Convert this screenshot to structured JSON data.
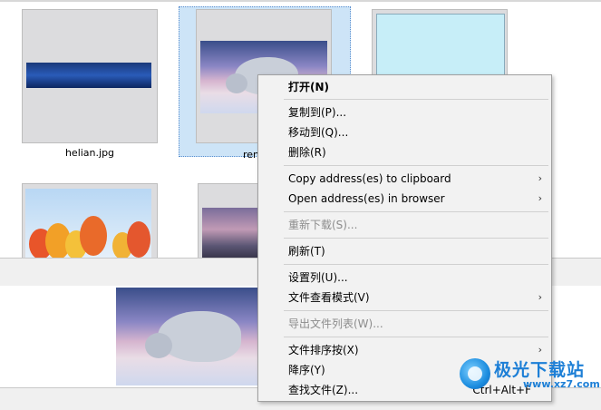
{
  "files": [
    {
      "name": "helian.jpg",
      "image": "blue-panorama"
    },
    {
      "name": "ren",
      "image": "flying-bison"
    },
    {
      "name": "",
      "image": "cyan-image"
    },
    {
      "name": "",
      "image": "autumn-trees"
    },
    {
      "name": "",
      "image": "mountain-dusk"
    }
  ],
  "context_menu": {
    "items": [
      {
        "label": "打开(N)",
        "bold": true
      },
      {
        "label": "复制到(P)..."
      },
      {
        "label": "移动到(Q)..."
      },
      {
        "label": "删除(R)"
      },
      {
        "label": "Copy address(es) to clipboard",
        "submenu": true
      },
      {
        "label": "Open address(es) in browser",
        "submenu": true
      },
      {
        "label": "重新下载(S)...",
        "disabled": true
      },
      {
        "label": "刷新(T)"
      },
      {
        "label": "设置列(U)..."
      },
      {
        "label": "文件查看模式(V)",
        "submenu": true
      },
      {
        "label": "导出文件列表(W)...",
        "disabled": true
      },
      {
        "label": "文件排序按(X)",
        "submenu": true
      },
      {
        "label": "降序(Y)"
      },
      {
        "label": "查找文件(Z)...",
        "shortcut": "Ctrl+Alt+F"
      }
    ],
    "arrow_glyph": "›"
  },
  "watermark": {
    "brand": "极光下载站",
    "url": "www.xz7.com"
  },
  "colors": {
    "selection": "#cde4f7",
    "menu_bg": "#f2f2f2",
    "watermark": "#1d7fd6"
  }
}
